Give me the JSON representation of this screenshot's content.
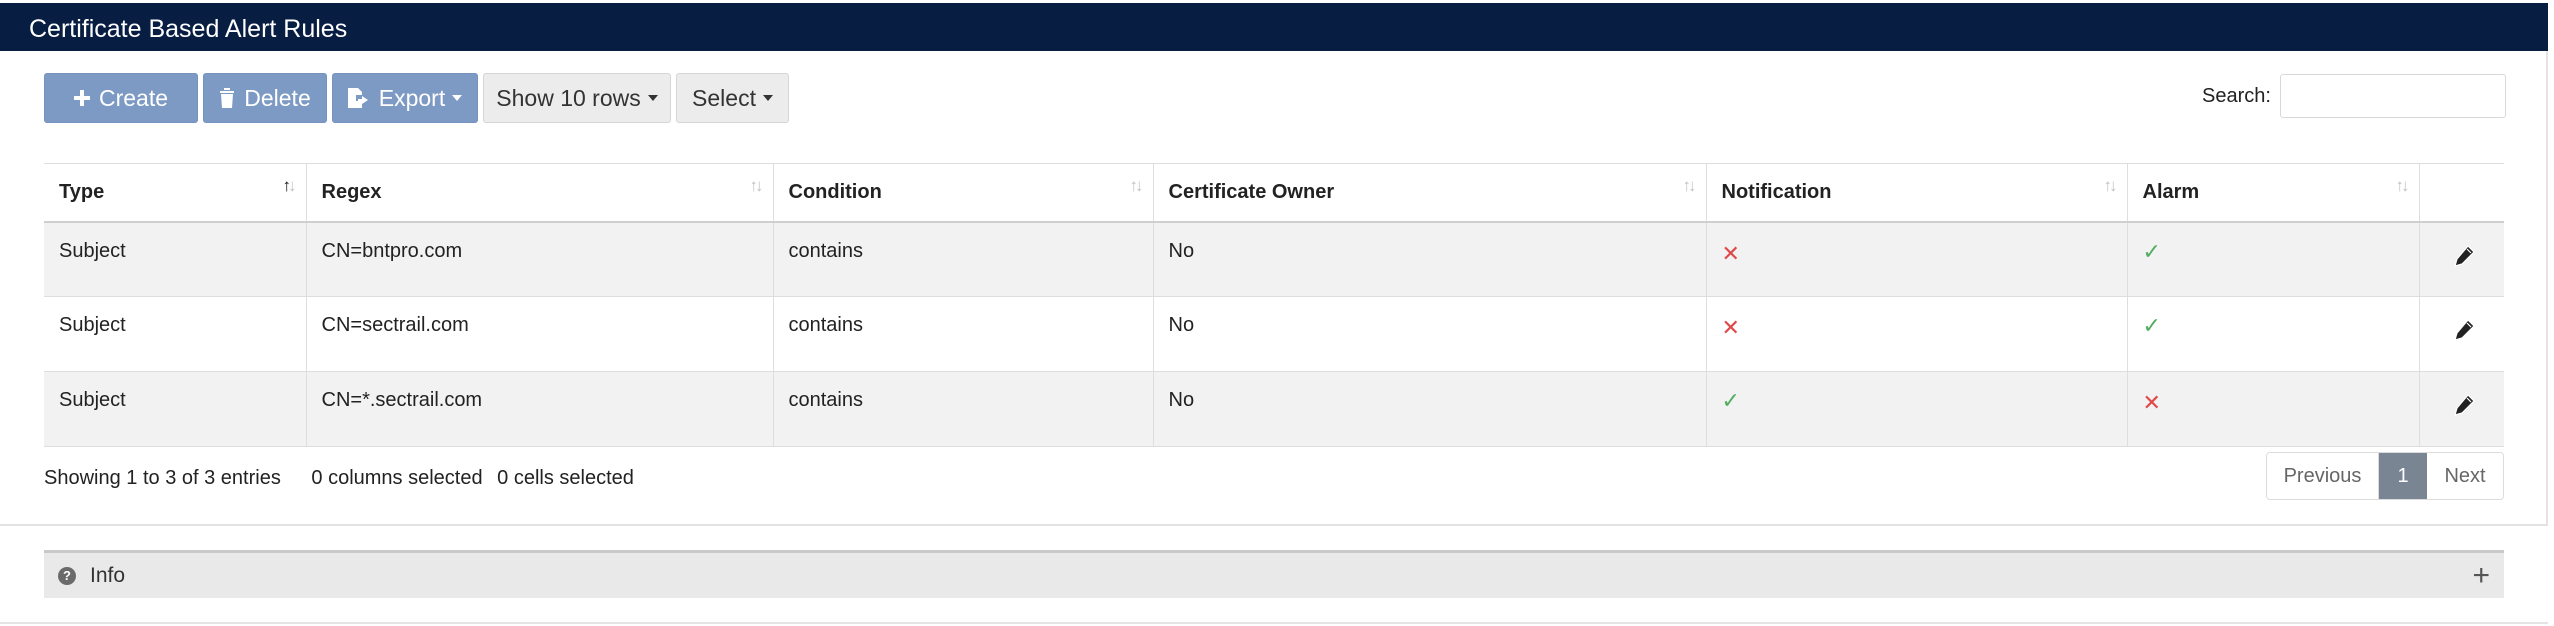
{
  "header": {
    "title": "Certificate Based Alert Rules"
  },
  "toolbar": {
    "create_label": "Create",
    "delete_label": "Delete",
    "export_label": "Export",
    "show_rows_label": "Show 10 rows",
    "select_label": "Select"
  },
  "search": {
    "label": "Search:",
    "value": ""
  },
  "table": {
    "columns": [
      "Type",
      "Regex",
      "Condition",
      "Certificate Owner",
      "Notification",
      "Alarm"
    ],
    "rows": [
      {
        "type": "Subject",
        "regex": "CN=bntpro.com",
        "condition": "contains",
        "owner": "No",
        "notification": "x-icon",
        "alarm": "check-icon"
      },
      {
        "type": "Subject",
        "regex": "CN=sectrail.com",
        "condition": "contains",
        "owner": "No",
        "notification": "x-icon",
        "alarm": "check-icon"
      },
      {
        "type": "Subject",
        "regex": "CN=*.sectrail.com",
        "condition": "contains",
        "owner": "No",
        "notification": "check-icon",
        "alarm": "x-icon"
      }
    ]
  },
  "footer": {
    "entries_info": "Showing 1 to 3 of 3 entries",
    "columns_selected": "0 columns selected",
    "cells_selected": "0 cells selected"
  },
  "pagination": {
    "previous": "Previous",
    "current": "1",
    "next": "Next"
  },
  "info_panel": {
    "label": "Info"
  },
  "colors": {
    "header_bg": "#071e42",
    "primary_button": "#7d9ac4",
    "x_mark": "#e04848",
    "check_mark": "#52ad61"
  }
}
